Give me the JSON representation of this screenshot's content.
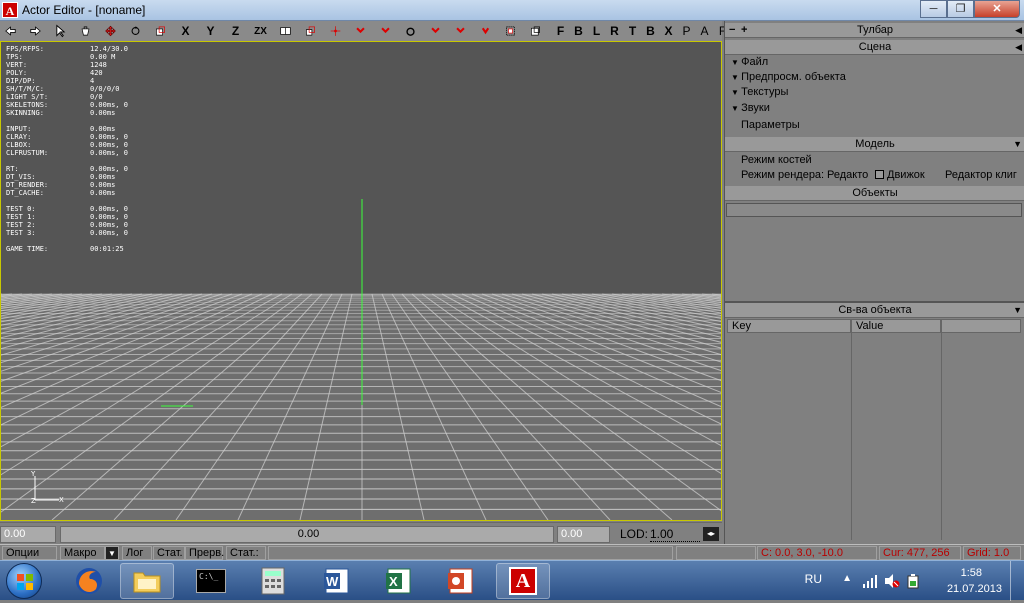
{
  "window": {
    "title": "Actor Editor - [noname]",
    "icon_letter": "A",
    "minimize": "─",
    "maximize": "❐",
    "close": "✕"
  },
  "toolbar": {
    "axis_x": "X",
    "axis_y": "Y",
    "axis_z": "Z",
    "axis_zx": "ZX",
    "view_f": "F",
    "view_b": "B",
    "view_l": "L",
    "view_r": "R",
    "view_t": "T",
    "view_bo": "B",
    "view_x": "X",
    "view_p": "P",
    "view_a": "A",
    "view_f2": "F"
  },
  "stats": [
    {
      "label": "FPS/RFPS:",
      "value": "12.4/30.0"
    },
    {
      "label": "TPS:",
      "value": "0.00 M"
    },
    {
      "label": "VERT:",
      "value": "1248"
    },
    {
      "label": "POLY:",
      "value": "420"
    },
    {
      "label": "DIP/DP:",
      "value": "4"
    },
    {
      "label": "SH/T/M/C:",
      "value": "0/0/0/0"
    },
    {
      "label": "LIGHT S/T:",
      "value": "0/0"
    },
    {
      "label": "SKELETONS:",
      "value": "0.00ms, 0"
    },
    {
      "label": "SKINNING:",
      "value": "0.00ms"
    },
    {
      "label": "",
      "value": ""
    },
    {
      "label": "INPUT:",
      "value": "0.00ms"
    },
    {
      "label": "CLRAY:",
      "value": "0.00ms, 0"
    },
    {
      "label": "CLBOX:",
      "value": "0.00ms, 0"
    },
    {
      "label": "CLFRUSTUM:",
      "value": "0.00ms, 0"
    },
    {
      "label": "",
      "value": ""
    },
    {
      "label": "RT:",
      "value": "0.00ms, 0"
    },
    {
      "label": " DT_VIS:",
      "value": "0.00ms"
    },
    {
      "label": " DT_RENDER:",
      "value": "0.00ms"
    },
    {
      "label": " DT_CACHE:",
      "value": "0.00ms"
    },
    {
      "label": "",
      "value": ""
    },
    {
      "label": "TEST 0:",
      "value": "0.00ms, 0"
    },
    {
      "label": "TEST 1:",
      "value": "0.00ms, 0"
    },
    {
      "label": "TEST 2:",
      "value": "0.00ms, 0"
    },
    {
      "label": "TEST 3:",
      "value": "0.00ms, 0"
    },
    {
      "label": "",
      "value": ""
    },
    {
      "label": "GAME TIME:",
      "value": "00:01:25"
    }
  ],
  "axis_gizmo": {
    "y": "Y",
    "x": "X",
    "z": "Z"
  },
  "viewbar": {
    "left_value": "0.00",
    "center_value": "0.00",
    "right_value": "0.00",
    "lod_label": "LOD:",
    "lod_value": "1.00",
    "spin_symbol": "◂▸"
  },
  "statusbar": {
    "options": "Опции",
    "macro": "Макро",
    "log": "Лог",
    "stat": "Стат.",
    "prev": "Прерв.",
    "stat_label": "Стат.:",
    "coords": "C: 0.0, 3.0, -10.0",
    "cursor": "Cur: 477, 256",
    "grid": "Grid: 1.0"
  },
  "rpanel": {
    "toolbar_title": "Тулбар",
    "toolbar_minus": "−",
    "toolbar_plus": "+",
    "scene_title": "Сцена",
    "scene_items": [
      "Файл",
      "Предпросм. объекта",
      "Текстуры",
      "Звуки"
    ],
    "scene_params": "Параметры",
    "model_title": "Модель",
    "bone_mode": "Режим костей",
    "render_mode_label": "Режим рендера:",
    "render_mode_value": "Редакто",
    "engine_label": "Движок",
    "clip_editor": "Редактор клиг",
    "objects_title": "Объекты",
    "props_title": "Св-ва объекта",
    "col_key": "Key",
    "col_value": "Value"
  },
  "taskbar": {
    "lang": "RU",
    "time": "1:58",
    "date": "21.07.2013",
    "cmd_text": "C:\\_"
  },
  "colors": {
    "grid_line": "#cfcfcf",
    "viewport_bg": "#555555",
    "viewport_border": "#c8c800",
    "status_red": "#b80000"
  }
}
